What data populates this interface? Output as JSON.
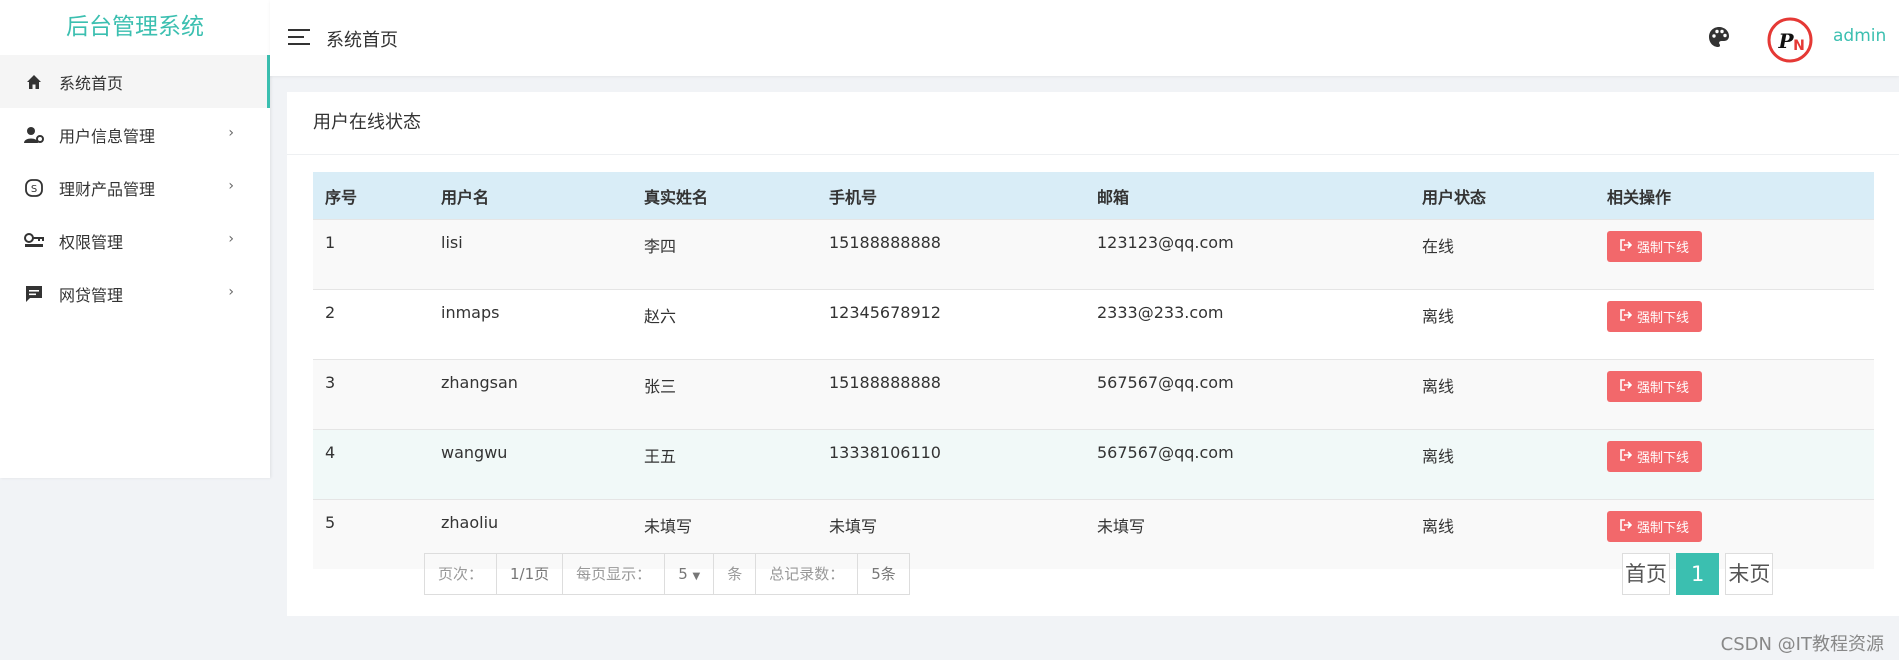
{
  "sidebar": {
    "brand": "后台管理系统",
    "items": [
      {
        "label": "系统首页",
        "icon": "home-icon"
      },
      {
        "label": "用户信息管理",
        "icon": "user-settings-icon"
      },
      {
        "label": "理财产品管理",
        "icon": "finance-icon"
      },
      {
        "label": "权限管理",
        "icon": "key-icon"
      },
      {
        "label": "网贷管理",
        "icon": "message-icon"
      }
    ]
  },
  "header": {
    "title": "系统首页",
    "username": "admin"
  },
  "card": {
    "title": "用户在线状态",
    "columns": [
      "序号",
      "用户名",
      "真实姓名",
      "手机号",
      "邮箱",
      "用户状态",
      "相关操作"
    ],
    "rows": [
      {
        "no": "1",
        "username": "lisi",
        "realname": "李四",
        "phone": "15188888888",
        "email": "123123@qq.com",
        "status": "在线",
        "action": "强制下线"
      },
      {
        "no": "2",
        "username": "inmaps",
        "realname": "赵六",
        "phone": "12345678912",
        "email": "2333@233.com",
        "status": "离线",
        "action": "强制下线"
      },
      {
        "no": "3",
        "username": "zhangsan",
        "realname": "张三",
        "phone": "15188888888",
        "email": "567567@qq.com",
        "status": "离线",
        "action": "强制下线"
      },
      {
        "no": "4",
        "username": "wangwu",
        "realname": "王五",
        "phone": "13338106110",
        "email": "567567@qq.com",
        "status": "离线",
        "action": "强制下线"
      },
      {
        "no": "5",
        "username": "zhaoliu",
        "realname": "未填写",
        "phone": "未填写",
        "email": "未填写",
        "status": "离线",
        "action": "强制下线"
      }
    ]
  },
  "pager": {
    "page_label": "页次：",
    "page_value": "1/1页",
    "per_page_label": "每页显示：",
    "per_page_value": "5",
    "per_page_unit": "条",
    "total_label": "总记录数：",
    "total_value": "5条",
    "first": "首页",
    "current": "1",
    "last": "末页"
  },
  "watermark": "CSDN @IT教程资源",
  "colors": {
    "accent": "#3bbfb0",
    "danger": "#f2686b",
    "table_header": "#d9edf7"
  }
}
